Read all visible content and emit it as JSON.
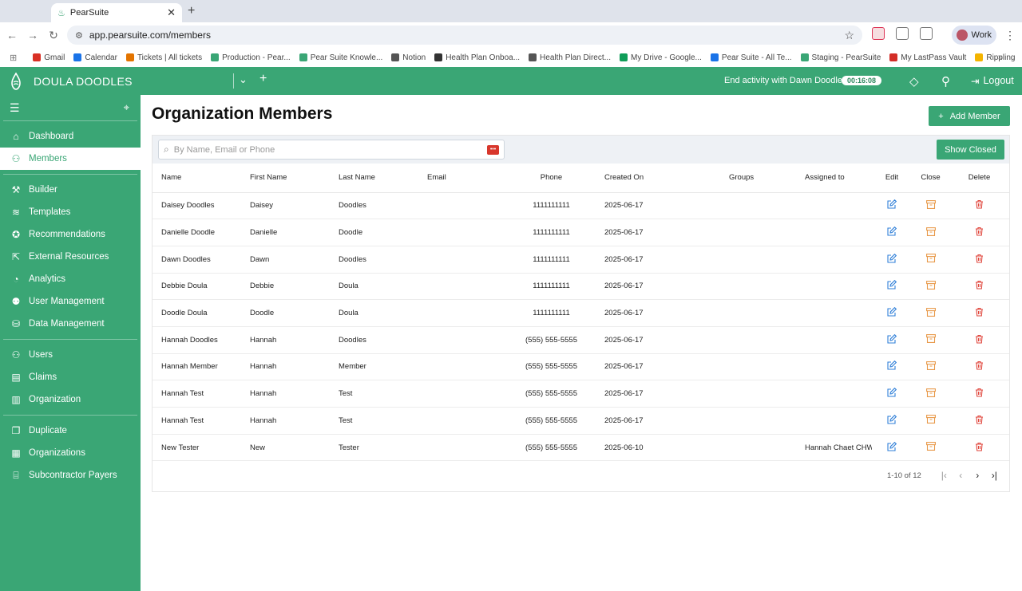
{
  "browser": {
    "tab_title": "PearSuite",
    "url": "app.pearsuite.com/members",
    "profile_label": "Work",
    "bookmarks": [
      {
        "label": "Gmail",
        "color": "#d93025"
      },
      {
        "label": "Calendar",
        "color": "#1a73e8"
      },
      {
        "label": "Tickets | All tickets",
        "color": "#e37400"
      },
      {
        "label": "Production - Pear...",
        "color": "#3aa675"
      },
      {
        "label": "Pear Suite Knowle...",
        "color": "#3aa675"
      },
      {
        "label": "Notion",
        "color": "#555555"
      },
      {
        "label": "Health Plan Onboa...",
        "color": "#333333"
      },
      {
        "label": "Health Plan Direct...",
        "color": "#555555"
      },
      {
        "label": "My Drive - Google...",
        "color": "#0f9d58"
      },
      {
        "label": "Pear Suite - All Te...",
        "color": "#1a73e8"
      },
      {
        "label": "Staging - PearSuite",
        "color": "#3aa675"
      },
      {
        "label": "My LastPass Vault",
        "color": "#d32d27"
      },
      {
        "label": "Rippling",
        "color": "#f4b400"
      }
    ]
  },
  "header": {
    "org_name": "DOULA DOODLES",
    "activity_text": "End activity with Dawn Doodles",
    "timer": "00:16:08",
    "logout_label": "Logout"
  },
  "sidebar": {
    "groups": [
      [
        {
          "label": "Dashboard",
          "icon": "home-icon",
          "glyph": "⌂"
        },
        {
          "label": "Members",
          "icon": "member-icon",
          "glyph": "⚇",
          "active": true
        }
      ],
      [
        {
          "label": "Builder",
          "icon": "wrench-icon",
          "glyph": "⚒"
        },
        {
          "label": "Templates",
          "icon": "layers-icon",
          "glyph": "≋"
        },
        {
          "label": "Recommendations",
          "icon": "award-icon",
          "glyph": "✪"
        },
        {
          "label": "External Resources",
          "icon": "external-link-icon",
          "glyph": "⇱"
        },
        {
          "label": "Analytics",
          "icon": "pie-chart-icon",
          "glyph": "◔"
        },
        {
          "label": "User Management",
          "icon": "users-icon",
          "glyph": "⚉"
        },
        {
          "label": "Data Management",
          "icon": "database-icon",
          "glyph": "⛁"
        }
      ],
      [
        {
          "label": "Users",
          "icon": "user-plus-icon",
          "glyph": "⚇"
        },
        {
          "label": "Claims",
          "icon": "archive-icon",
          "glyph": "▤"
        },
        {
          "label": "Organization",
          "icon": "building-icon",
          "glyph": "▥"
        }
      ],
      [
        {
          "label": "Duplicate",
          "icon": "copy-icon",
          "glyph": "❐"
        },
        {
          "label": "Organizations",
          "icon": "buildings-icon",
          "glyph": "▦"
        },
        {
          "label": "Subcontractor Payers",
          "icon": "bank-icon",
          "glyph": "⌸"
        }
      ]
    ]
  },
  "main": {
    "title": "Organization Members",
    "add_button": "Add Member",
    "search_placeholder": "By Name, Email or Phone",
    "show_closed_button": "Show Closed",
    "columns": [
      "Name",
      "First Name",
      "Last Name",
      "Email",
      "Phone",
      "Created On",
      "Groups",
      "Assigned to",
      "Edit",
      "Close",
      "Delete"
    ],
    "rows": [
      {
        "name": "Daisey Doodles",
        "first": "Daisey",
        "last": "Doodles",
        "email": "",
        "phone": "1111111111",
        "created": "2025-06-17",
        "groups": "",
        "assigned": ""
      },
      {
        "name": "Danielle Doodle",
        "first": "Danielle",
        "last": "Doodle",
        "email": "",
        "phone": "1111111111",
        "created": "2025-06-17",
        "groups": "",
        "assigned": ""
      },
      {
        "name": "Dawn Doodles",
        "first": "Dawn",
        "last": "Doodles",
        "email": "",
        "phone": "1111111111",
        "created": "2025-06-17",
        "groups": "",
        "assigned": ""
      },
      {
        "name": "Debbie Doula",
        "first": "Debbie",
        "last": "Doula",
        "email": "",
        "phone": "1111111111",
        "created": "2025-06-17",
        "groups": "",
        "assigned": ""
      },
      {
        "name": "Doodle Doula",
        "first": "Doodle",
        "last": "Doula",
        "email": "",
        "phone": "1111111111",
        "created": "2025-06-17",
        "groups": "",
        "assigned": ""
      },
      {
        "name": "Hannah Doodles",
        "first": "Hannah",
        "last": "Doodles",
        "email": "",
        "phone": "(555) 555-5555",
        "created": "2025-06-17",
        "groups": "",
        "assigned": ""
      },
      {
        "name": "Hannah Member",
        "first": "Hannah",
        "last": "Member",
        "email": "",
        "phone": "(555) 555-5555",
        "created": "2025-06-17",
        "groups": "",
        "assigned": ""
      },
      {
        "name": "Hannah Test",
        "first": "Hannah",
        "last": "Test",
        "email": "",
        "phone": "(555) 555-5555",
        "created": "2025-06-17",
        "groups": "",
        "assigned": ""
      },
      {
        "name": "Hannah Test",
        "first": "Hannah",
        "last": "Test",
        "email": "",
        "phone": "(555) 555-5555",
        "created": "2025-06-17",
        "groups": "",
        "assigned": ""
      },
      {
        "name": "New Tester",
        "first": "New",
        "last": "Tester",
        "email": "",
        "phone": "(555) 555-5555",
        "created": "2025-06-10",
        "groups": "",
        "assigned": "Hannah Chaet CHW"
      }
    ],
    "pagination": "1-10 of 12"
  },
  "colors": {
    "brand": "#3aa675",
    "edit": "#2f7fd8",
    "close": "#e8994a",
    "delete": "#e0463c"
  }
}
